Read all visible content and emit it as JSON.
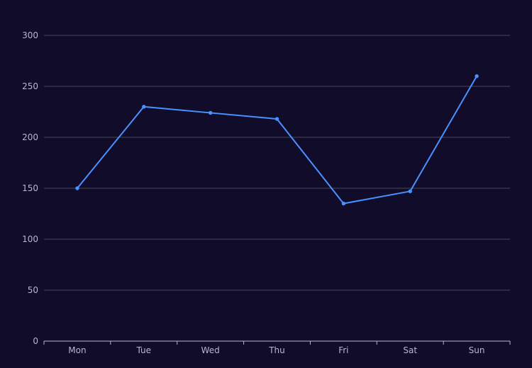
{
  "chart_data": {
    "type": "line",
    "title": "",
    "xlabel": "",
    "ylabel": "",
    "categories": [
      "Mon",
      "Tue",
      "Wed",
      "Thu",
      "Fri",
      "Sat",
      "Sun"
    ],
    "series": [
      {
        "values": [
          150,
          230,
          224,
          218,
          135,
          147,
          260
        ]
      }
    ],
    "ylim": [
      0,
      300
    ],
    "yticks": [
      0,
      50,
      100,
      150,
      200,
      250,
      300
    ],
    "grid": true,
    "legend": "none"
  },
  "colors": {
    "background": "#100c2a",
    "series": "#4992ff",
    "grid": "#484753",
    "axis": "#b9b8ce"
  }
}
